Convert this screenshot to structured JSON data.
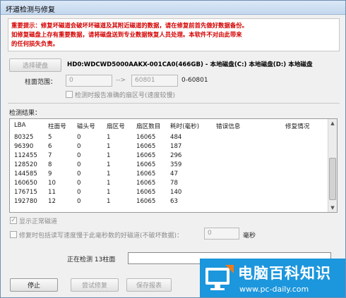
{
  "window": {
    "title": "坏道检测与修复"
  },
  "warning": {
    "lines": [
      "重要提示：修复坏磁道会破坏坏磁道及其附近磁道的数据，请在修复前首先做好数据备份。",
      "如修复磁盘上存有重要数据，请将磁盘送到专业数据恢复人员处理。本软件不对由此带来",
      "的任何损失负责。"
    ]
  },
  "disk": {
    "select_label": "选择硬盘",
    "info": "HD0:WDCWD5000AAKX-001CA0(466GB) - 本地磁盘(C:) 本地磁盘(D:) 本地磁盘"
  },
  "range": {
    "label": "柱面范围：",
    "from": "0",
    "arrow": "-->",
    "to": "60801",
    "hint": "0-60801"
  },
  "options": {
    "report_sectors": "检测时报告准确的扇区号(速度较慢)",
    "show_normal": "显示正常磁道",
    "repair_slow": "修复时包括读写速度慢于此毫秒数的好磁道(不破坏数据)：",
    "repair_slow_value": "0",
    "repair_slow_unit": "毫秒"
  },
  "results": {
    "label": "检测结果：",
    "columns": [
      "LBA",
      "柱面号",
      "磁头号",
      "扇区号",
      "扇区数目",
      "耗时(毫秒)",
      "错误信息",
      "修复情况"
    ],
    "rows": [
      [
        "80325",
        "5",
        "0",
        "1",
        "16065",
        "484",
        "",
        ""
      ],
      [
        "96390",
        "6",
        "0",
        "1",
        "16065",
        "187",
        "",
        ""
      ],
      [
        "112455",
        "7",
        "0",
        "1",
        "16065",
        "296",
        "",
        ""
      ],
      [
        "128520",
        "8",
        "0",
        "1",
        "16065",
        "359",
        "",
        ""
      ],
      [
        "144585",
        "9",
        "0",
        "1",
        "16065",
        "47",
        "",
        ""
      ],
      [
        "160650",
        "10",
        "0",
        "1",
        "16065",
        "78",
        "",
        ""
      ],
      [
        "176715",
        "11",
        "0",
        "1",
        "16065",
        "140",
        "",
        ""
      ],
      [
        "192780",
        "12",
        "0",
        "1",
        "16065",
        "63",
        "",
        ""
      ]
    ]
  },
  "status": {
    "text": "正在检测  13柱面"
  },
  "buttons": {
    "stop": "停止",
    "try_repair": "尝试修复",
    "save_report": "保存报表"
  },
  "watermark": {
    "name": "电脑百科知识",
    "url": "www.pc-daily.com"
  },
  "colors": {
    "warning": "#d40000",
    "logo_bg": "#1c96dc",
    "logo_accent": "#f07a1a"
  }
}
